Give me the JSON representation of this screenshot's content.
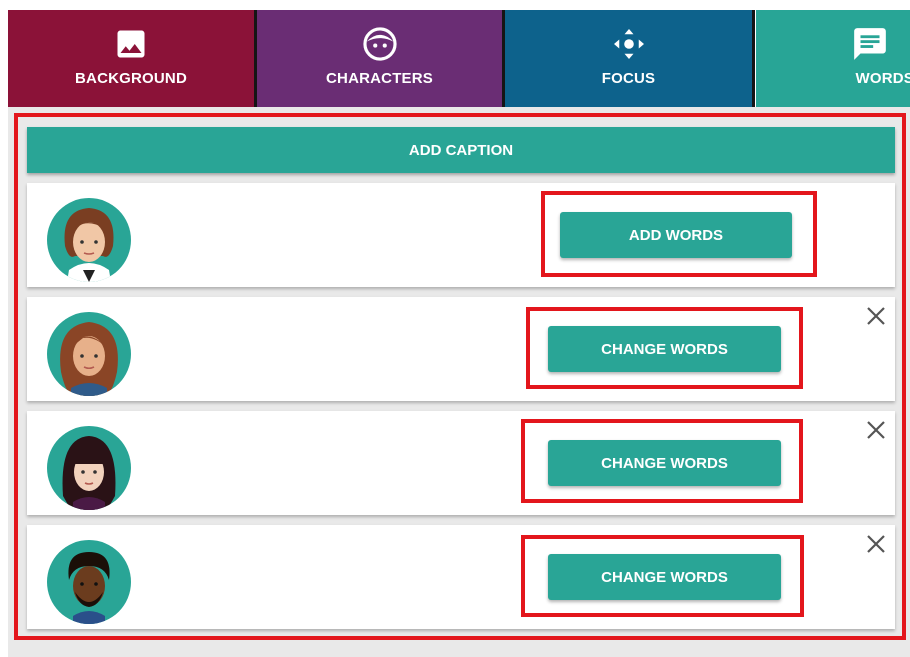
{
  "tabs": [
    {
      "label": "BACKGROUND",
      "icon": "image-icon"
    },
    {
      "label": "CHARACTERS",
      "icon": "face-icon"
    },
    {
      "label": "FOCUS",
      "icon": "move-arrows-icon"
    },
    {
      "label": "WORDS",
      "icon": "comment-icon"
    }
  ],
  "add_caption_label": "ADD CAPTION",
  "rows": [
    {
      "avatar": "woman-brown-bob-avatar",
      "button_label": "ADD WORDS",
      "closable": false
    },
    {
      "avatar": "woman-auburn-long-avatar",
      "button_label": "CHANGE WORDS",
      "closable": true
    },
    {
      "avatar": "woman-dark-bangs-avatar",
      "button_label": "CHANGE WORDS",
      "closable": true
    },
    {
      "avatar": "man-curly-beard-avatar",
      "button_label": "CHANGE WORDS",
      "closable": true
    }
  ],
  "colors": {
    "background_tab": "#8b1238",
    "characters_tab": "#6a2d74",
    "focus_tab": "#0d628c",
    "words_tab": "#28a596",
    "button": "#29a596",
    "highlight": "#e3161c"
  }
}
